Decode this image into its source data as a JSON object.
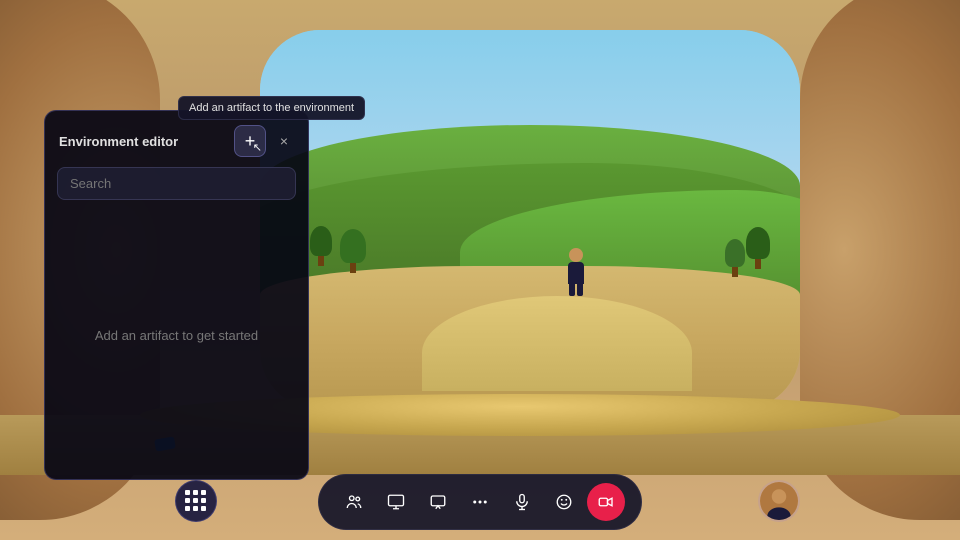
{
  "environment": {
    "title": "3D virtual environment"
  },
  "tooltip": {
    "text": "Add an artifact to the environment"
  },
  "panel": {
    "title": "Environment editor",
    "search_placeholder": "Search",
    "empty_state": "Add an artifact to get started",
    "add_button_label": "+",
    "close_button_label": "×"
  },
  "toolbar": {
    "buttons": [
      {
        "id": "people",
        "icon": "people-icon",
        "label": "People"
      },
      {
        "id": "screen-share",
        "icon": "screen-share-icon",
        "label": "Screen Share"
      },
      {
        "id": "present",
        "icon": "present-icon",
        "label": "Present"
      },
      {
        "id": "more",
        "icon": "more-icon",
        "label": "More"
      },
      {
        "id": "microphone",
        "icon": "microphone-icon",
        "label": "Microphone"
      },
      {
        "id": "emoji",
        "icon": "emoji-icon",
        "label": "Emoji"
      },
      {
        "id": "record",
        "icon": "record-icon",
        "label": "Record",
        "active": true
      }
    ],
    "apps_label": "Apps",
    "avatar_label": "Your avatar"
  }
}
